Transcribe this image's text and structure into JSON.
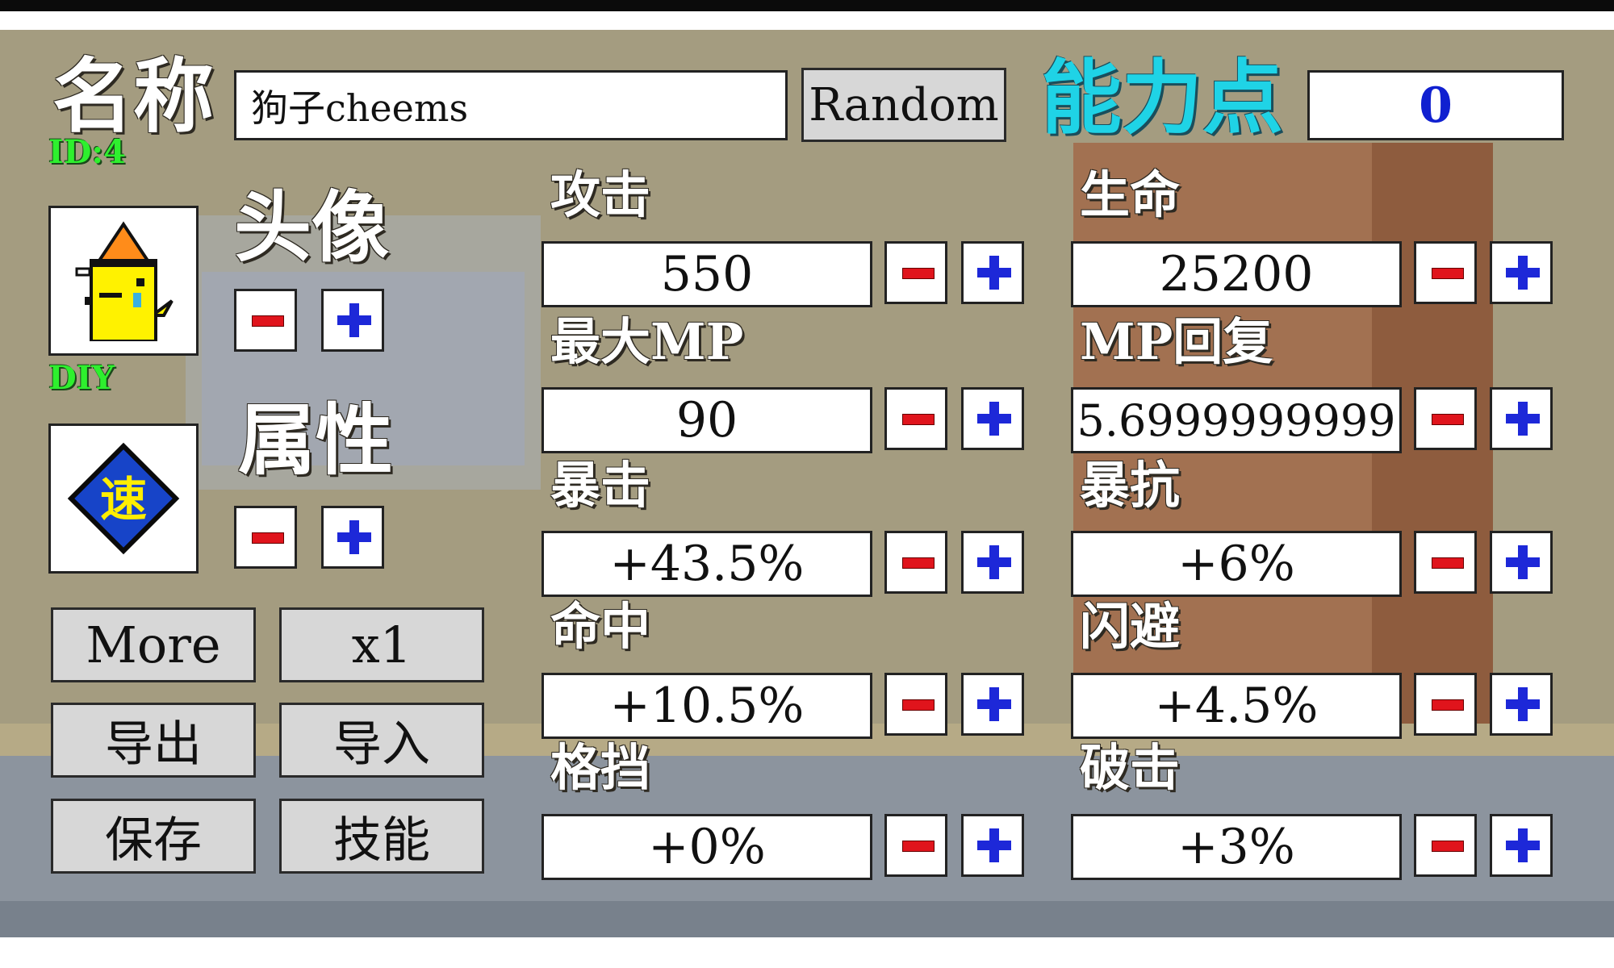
{
  "header": {
    "name_label": "名称",
    "name_value": "狗子cheems",
    "random_label": "Random",
    "points_label": "能力点",
    "points_value": "0",
    "id_label": "ID:4"
  },
  "avatar": {
    "label": "头像",
    "tag": "DIY",
    "icon": "yellow-bird-with-hat-icon"
  },
  "attribute": {
    "label": "属性",
    "icon_char": "速",
    "icon": "speed-diamond-icon"
  },
  "buttons": {
    "more": "More",
    "multiplier": "x1",
    "export": "导出",
    "import": "导入",
    "save": "保存",
    "skills": "技能"
  },
  "stats": [
    {
      "key": "attack",
      "label": "攻击",
      "value": "550"
    },
    {
      "key": "hp",
      "label": "生命",
      "value": "25200"
    },
    {
      "key": "max-mp",
      "label": "最大MP",
      "value": "90"
    },
    {
      "key": "mp-regen",
      "label": "MP回复",
      "value": "5.6999999999"
    },
    {
      "key": "crit",
      "label": "暴击",
      "value": "+43.5%"
    },
    {
      "key": "crit-resist",
      "label": "暴抗",
      "value": "+6%"
    },
    {
      "key": "hit",
      "label": "命中",
      "value": "+10.5%"
    },
    {
      "key": "dodge",
      "label": "闪避",
      "value": "+4.5%"
    },
    {
      "key": "block",
      "label": "格挡",
      "value": "+0%"
    },
    {
      "key": "break",
      "label": "破击",
      "value": "+3%"
    }
  ],
  "colors": {
    "points_label": "#1fd3e6",
    "points_value": "#1020d0",
    "minus": "#e0141c",
    "plus": "#1d28d8",
    "tag_green": "#2ef02e"
  }
}
